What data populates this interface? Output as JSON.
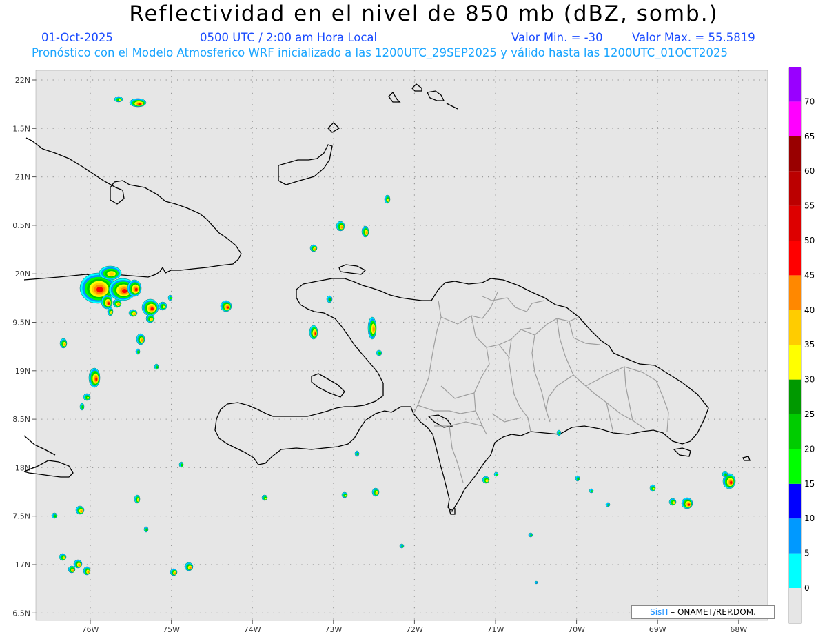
{
  "header": {
    "title": "Reflectividad en el nivel de 850 mb (dBZ, somb.)",
    "date": "01-Oct-2025",
    "time": "0500 UTC / 2:00 am Hora Local",
    "min_value": "Valor Min. = -30",
    "max_value": "Valor Max. = 55.5819",
    "description": "Pronóstico con el Modelo Atmosferico WRF inicializado a las 1200UTC_29SEP2025 y válido hasta las 1200UTC_01OCT2025"
  },
  "axes": {
    "lat_labels": [
      "22N",
      "1.5N",
      "21N",
      "0.5N",
      "20N",
      "9.5N",
      "19N",
      "8.5N",
      "18N",
      "7.5N",
      "17N",
      "6.5N"
    ],
    "lon_labels": [
      "76W",
      "75W",
      "74W",
      "73W",
      "72W",
      "71W",
      "70W",
      "69W",
      "68W"
    ]
  },
  "colorbar": {
    "labels": [
      "0",
      "5",
      "10",
      "15",
      "20",
      "25",
      "30",
      "35",
      "40",
      "45",
      "50",
      "55",
      "60",
      "65",
      "70"
    ],
    "colors": [
      "#00ffff",
      "#0099ff",
      "#0000ff",
      "#00ff00",
      "#00cc00",
      "#009900",
      "#ffff00",
      "#ffcc00",
      "#ff8800",
      "#ff0000",
      "#dd0000",
      "#bb0000",
      "#990000",
      "#ff00ff",
      "#9900ff"
    ],
    "below_color": "#e6e6e6"
  },
  "credit": {
    "brand": "SisΠ",
    "org": "– ONAMET/REP.DOM."
  },
  "colors": {
    "map_background": "#e6e6e6",
    "coastline": "#000000",
    "provinces": "#999999",
    "title": "#000000",
    "subtitle": "#1a4bff",
    "description": "#1aa5ff"
  }
}
